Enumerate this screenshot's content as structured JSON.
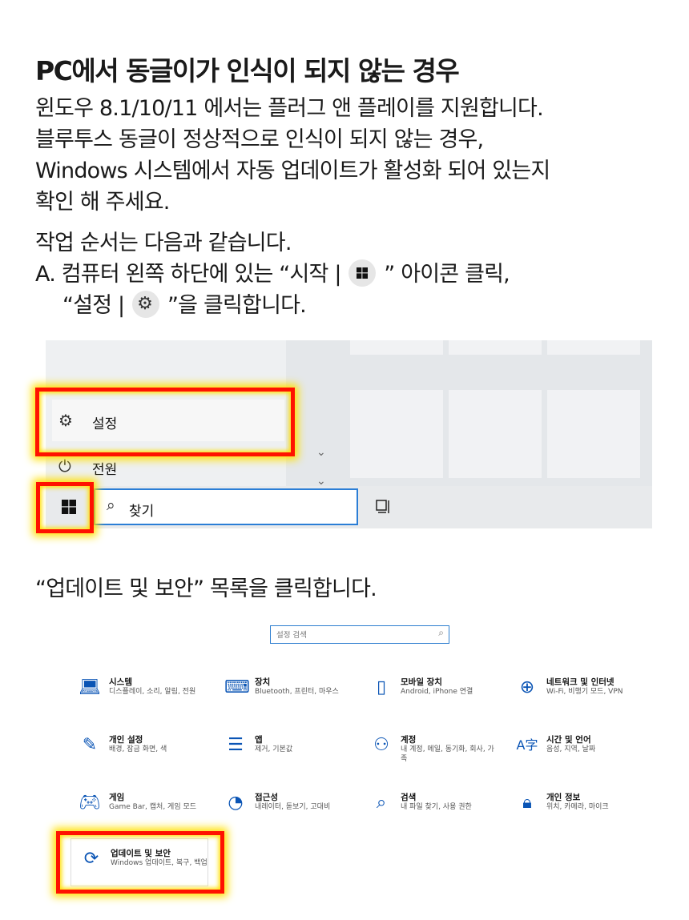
{
  "title": "PC에서 동글이가 인식이 되지 않는 경우",
  "intro_lines": [
    "윈도우 8.1/10/11 에서는 플러그 앤 플레이를 지원합니다.",
    "블루투스 동글이 정상적으로 인식이 되지 않는 경우,",
    "Windows 시스템에서 자동 업데이트가 활성화 되어 있는지",
    "확인 해 주세요."
  ],
  "steps": {
    "heading": "작업 순서는 다음과 같습니다.",
    "a_before_icon": "A. 컴퓨터 왼쪽 하단에 있는 “시작 |",
    "a_after_icon": "” 아이콘 클릭,",
    "b_before_icon": "“설정 |",
    "b_after_icon": "”을 클릭합니다."
  },
  "start_menu": {
    "settings_label": "설정",
    "power_label": "전원",
    "search_label": "찾기"
  },
  "step2_text": "“업데이트 및 보안” 목록을 클릭합니다.",
  "settings_window": {
    "search_placeholder": "설정 검색",
    "categories": [
      {
        "icon": "laptop-icon",
        "title": "시스템",
        "desc": "디스플레이, 소리, 알림, 전원"
      },
      {
        "icon": "keyboard-icon",
        "title": "장치",
        "desc": "Bluetooth, 프린터, 마우스"
      },
      {
        "icon": "phone-icon",
        "title": "모바일 장치",
        "desc": "Android, iPhone 연결"
      },
      {
        "icon": "globe-icon",
        "title": "네트워크 및 인터넷",
        "desc": "Wi-Fi, 비행기 모드, VPN"
      },
      {
        "icon": "pen-icon",
        "title": "개인 설정",
        "desc": "배경, 잠금 화면, 색"
      },
      {
        "icon": "list-icon",
        "title": "앱",
        "desc": "제거, 기본값"
      },
      {
        "icon": "person-icon",
        "title": "계정",
        "desc": "내 계정, 메일, 동기화, 회사, 가족"
      },
      {
        "icon": "language-icon",
        "title": "시간 및 언어",
        "desc": "음성, 지역, 날짜"
      },
      {
        "icon": "gamepad-icon",
        "title": "게임",
        "desc": "Game Bar, 캡처, 게임 모드"
      },
      {
        "icon": "accessibility-icon",
        "title": "접근성",
        "desc": "내레이터, 돋보기, 고대비"
      },
      {
        "icon": "search-icon",
        "title": "검색",
        "desc": "내 파일 찾기, 사용 권한"
      },
      {
        "icon": "lock-icon",
        "title": "개인 정보",
        "desc": "위치, 카메라, 마이크"
      },
      {
        "icon": "sync-icon",
        "title": "업데이트 및 보안",
        "desc": "Windows 업데이트, 복구, 백업"
      }
    ]
  },
  "colors": {
    "highlight_border": "#ff1200",
    "highlight_glow": "#ffe000",
    "icon_blue": "#0b55b5"
  }
}
